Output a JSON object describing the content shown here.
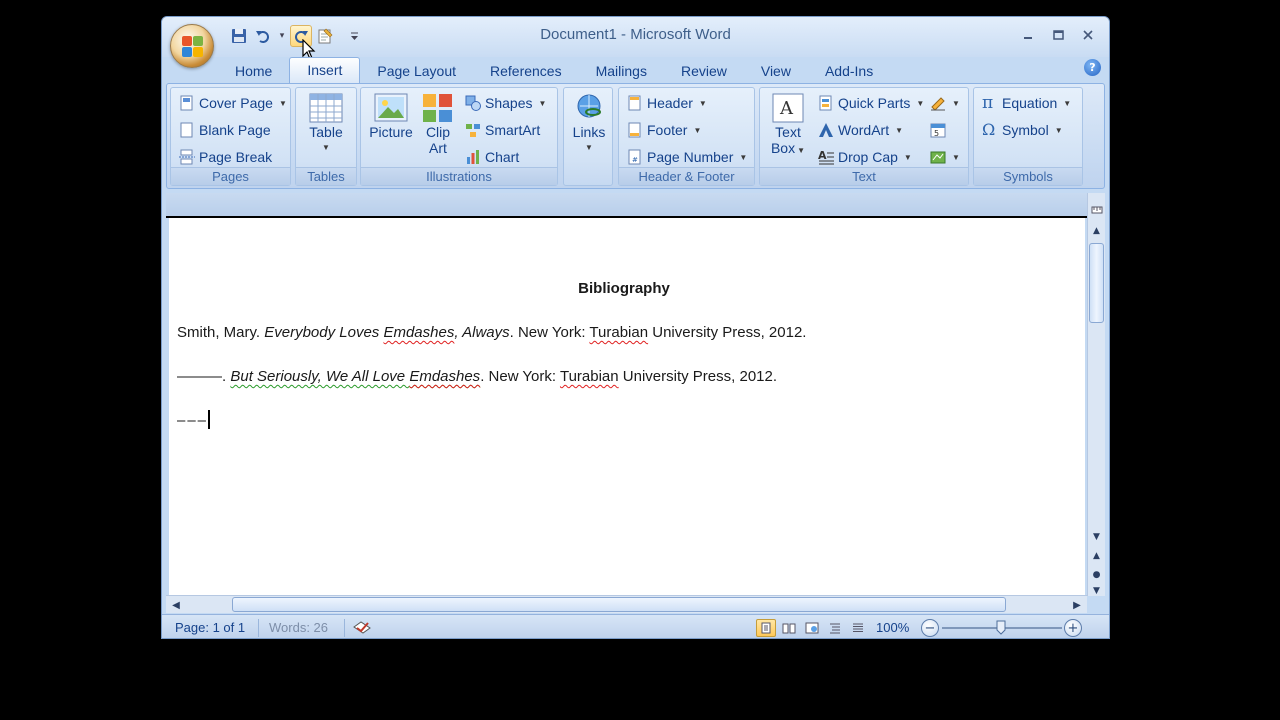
{
  "window": {
    "title": "Document1 - Microsoft Word"
  },
  "tabs": [
    "Home",
    "Insert",
    "Page Layout",
    "References",
    "Mailings",
    "Review",
    "View",
    "Add-Ins"
  ],
  "active_tab": "Insert",
  "ribbon": {
    "pages": {
      "label": "Pages",
      "cover_page": "Cover Page",
      "blank_page": "Blank Page",
      "page_break": "Page Break"
    },
    "tables": {
      "label": "Tables",
      "table": "Table"
    },
    "illustrations": {
      "label": "Illustrations",
      "picture": "Picture",
      "clip_art_1": "Clip",
      "clip_art_2": "Art",
      "shapes": "Shapes",
      "smartart": "SmartArt",
      "chart": "Chart"
    },
    "links": {
      "label": "",
      "links": "Links"
    },
    "header_footer": {
      "label": "Header & Footer",
      "header": "Header",
      "footer": "Footer",
      "page_number": "Page Number"
    },
    "text": {
      "label": "Text",
      "text_box_1": "Text",
      "text_box_2": "Box",
      "quick_parts": "Quick Parts",
      "wordart": "WordArt",
      "drop_cap": "Drop Cap"
    },
    "symbols": {
      "label": "Symbols",
      "equation": "Equation",
      "symbol": "Symbol"
    }
  },
  "document": {
    "heading": "Bibliography",
    "entry1": {
      "author": "Smith, Mary. ",
      "title_a": "Everybody Loves ",
      "title_b": "Emdashes",
      "title_c": ", Always",
      "rest_a": ". New York: ",
      "publisher_a": "Turabian",
      "rest_b": " University Press, 2012."
    },
    "entry2": {
      "dashes": "———.",
      "title_a": "But Seriously, We All Love ",
      "title_b": "Emdashes",
      "rest_a": ". New York: ",
      "publisher_a": "Turabian",
      "rest_b": " University Press, 2012."
    },
    "entry3": {
      "typing": "–––"
    }
  },
  "status": {
    "page": "Page: 1 of 1",
    "words": "Words: 26",
    "zoom": "100%"
  },
  "colors": {
    "accent": "#15428b",
    "ribbon": "#c4daf3",
    "misspell": "#e02020",
    "grammar": "#2a9a2a"
  }
}
